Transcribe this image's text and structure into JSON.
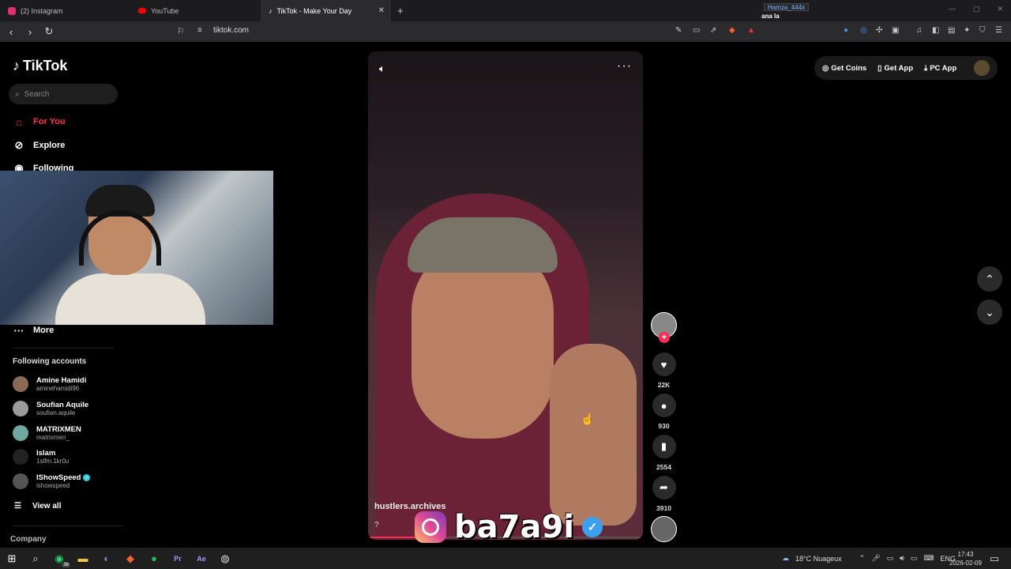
{
  "browser": {
    "tabs": [
      {
        "label": "(2) Instagram",
        "color": "#e1306c"
      },
      {
        "label": "YouTube",
        "color": "#ff0000"
      },
      {
        "label": "TikTok - Make Your Day",
        "color": "#ffffff",
        "active": true
      }
    ],
    "new_tab": "+",
    "url": "tiktok.com",
    "profile_name": "Hamza_444x",
    "profile_subtitle": "ana la"
  },
  "tiktok": {
    "logo_text": "TikTok",
    "search_placeholder": "Search",
    "nav": {
      "for_you": "For You",
      "explore": "Explore",
      "following": "Following",
      "more": "More"
    },
    "following_title": "Following accounts",
    "accounts": [
      {
        "name": "Amine Hamidi",
        "handle": "aminehamidi96",
        "verified": false
      },
      {
        "name": "Soufian Aquile",
        "handle": "soufian.aquile",
        "verified": false
      },
      {
        "name": "MATRIXMEN",
        "handle": "matrixmen_",
        "verified": false
      },
      {
        "name": "Islam",
        "handle": "1slfm.1kr0u",
        "verified": false
      },
      {
        "name": "IShowSpeed",
        "handle": "ishowspeed",
        "verified": true
      }
    ],
    "view_all": "View all",
    "company": "Company",
    "video": {
      "author": "hustlers.archives",
      "caption": "?",
      "progress": 0.2
    },
    "actions": {
      "likes": "22K",
      "comments": "930",
      "saves": "2554",
      "shares": "3910"
    },
    "header": {
      "get_coins": "Get Coins",
      "get_app": "Get App",
      "pc_app": "PC App"
    },
    "accent": "#fe2c55"
  },
  "overlay": {
    "brand": "ba7a9i"
  },
  "taskbar": {
    "badge": "36",
    "weather": "18°C  Nuageux",
    "lang": "ENG",
    "time": "17:43",
    "date": "2026-02-09"
  }
}
